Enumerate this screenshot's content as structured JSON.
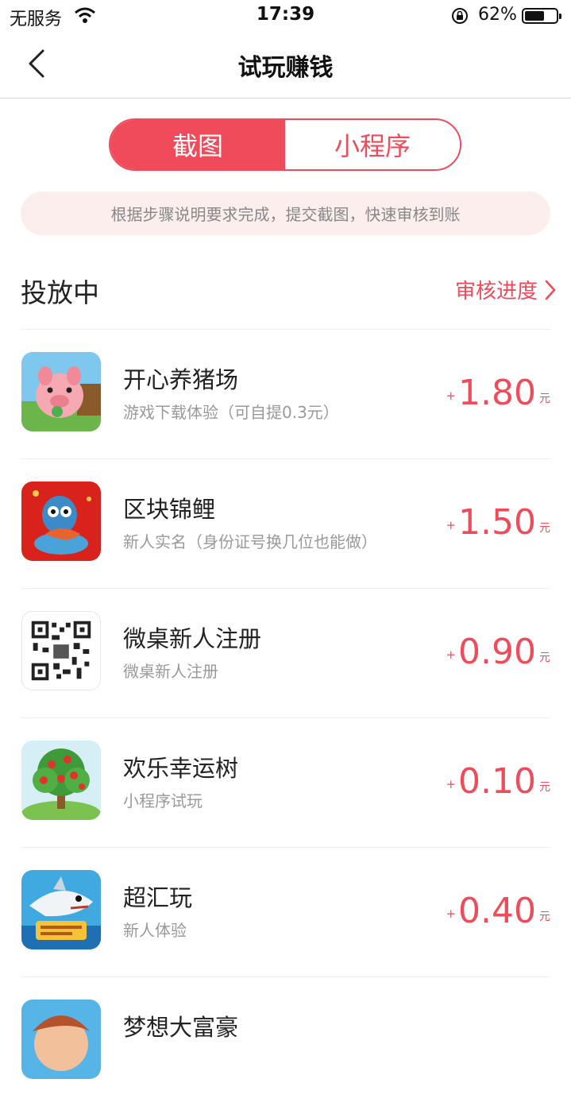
{
  "status_bar": {
    "carrier": "无服务",
    "time": "17:39",
    "battery": "62%",
    "battery_level": 0.62
  },
  "nav": {
    "title": "试玩赚钱"
  },
  "tabs": [
    {
      "label": "截图",
      "active": true
    },
    {
      "label": "小程序",
      "active": false
    }
  ],
  "hint": "根据步骤说明要求完成，提交截图，快速审核到账",
  "section": {
    "title": "投放中",
    "link": "审核进度"
  },
  "colors": {
    "accent": "#f04b5a",
    "hint_bg": "#fdeeee"
  },
  "tasks": [
    {
      "name": "开心养猪场",
      "desc": "游戏下载体验（可自提0.3元）",
      "plus": "+",
      "amount": "1.80",
      "unit": "元",
      "icon": "pig-farm-icon"
    },
    {
      "name": "区块锦鲤",
      "desc": "新人实名（身份证号换几位也能做）",
      "plus": "+",
      "amount": "1.50",
      "unit": "元",
      "icon": "koi-owl-icon"
    },
    {
      "name": "微桌新人注册",
      "desc": "微桌新人注册",
      "plus": "+",
      "amount": "0.90",
      "unit": "元",
      "icon": "qr-code-icon"
    },
    {
      "name": "欢乐幸运树",
      "desc": "小程序试玩",
      "plus": "+",
      "amount": "0.10",
      "unit": "元",
      "icon": "lucky-tree-icon"
    },
    {
      "name": "超汇玩",
      "desc": "新人体验",
      "plus": "+",
      "amount": "0.40",
      "unit": "元",
      "icon": "shark-game-icon"
    },
    {
      "name": "梦想大富豪",
      "desc": "",
      "plus": "",
      "amount": "",
      "unit": "",
      "icon": "tycoon-icon"
    }
  ]
}
